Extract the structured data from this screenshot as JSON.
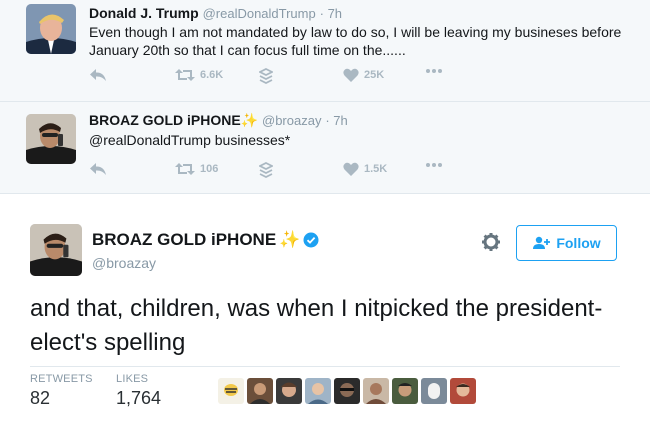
{
  "tweets": [
    {
      "name": "Donald J. Trump",
      "handle": "@realDonaldTrump",
      "time": "· 7h",
      "text": "Even though I am not mandated by law to do so, I will be leaving my busineses before January 20th so that I can focus full time on the......",
      "retweets": "6.6K",
      "likes": "25K"
    },
    {
      "name": "BROAZ GOLD iPHONE",
      "name_emoji": "✨",
      "handle": "@broazay",
      "time": "· 7h",
      "text": "@realDonaldTrump businesses*",
      "retweets": "106",
      "likes": "1.5K"
    }
  ],
  "main": {
    "name": "BROAZ GOLD iPHONE",
    "name_emoji": "✨",
    "handle": "@broazay",
    "follow_label": "Follow",
    "text": "and that, children, was when I nitpicked the president-elect's spelling",
    "retweets_label": "RETWEETS",
    "retweets": "82",
    "likes_label": "LIKES",
    "likes": "1,764"
  },
  "colors": {
    "accent": "#1da1f2",
    "muted": "#8899a6",
    "background_conversation": "#f5f8fa",
    "sparkle": "#b689e8"
  },
  "icons": {
    "reply": "reply-icon",
    "retweet": "retweet-icon",
    "stack": "stack-icon",
    "like": "heart-icon",
    "more": "more-icon",
    "gear": "gear-icon",
    "verified": "verified-badge-icon",
    "follow": "add-user-icon"
  }
}
